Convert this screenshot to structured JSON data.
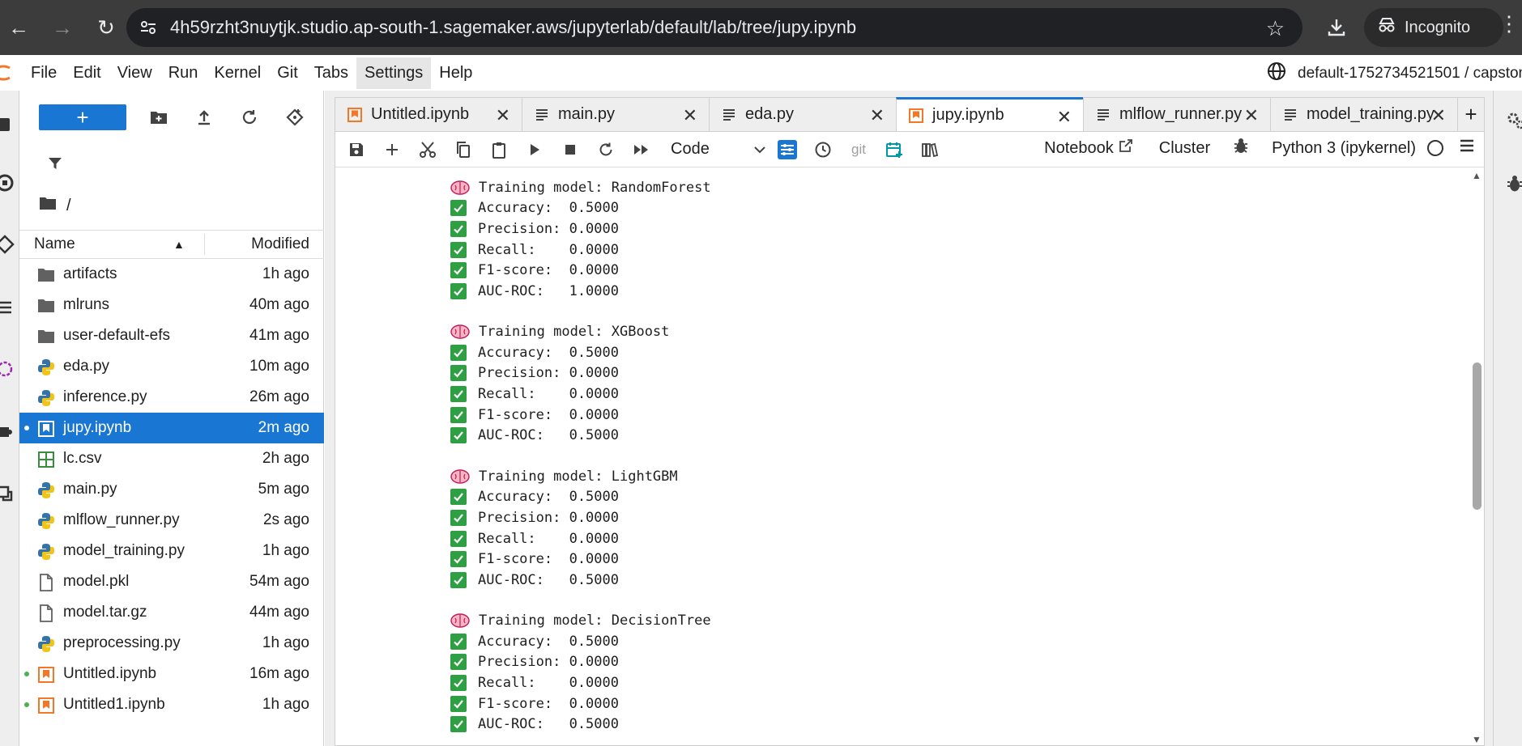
{
  "browser": {
    "url": "4h59rzht3nuytjk.studio.ap-south-1.sagemaker.aws/jupyterlab/default/lab/tree/jupy.ipynb",
    "incognito_label": "Incognito"
  },
  "menubar": {
    "items": [
      "File",
      "Edit",
      "View",
      "Run",
      "Kernel",
      "Git",
      "Tabs",
      "Settings",
      "Help"
    ],
    "active": "Settings",
    "workspace": "default-1752734521501 / capstone"
  },
  "filebrowser": {
    "path": "/",
    "columns": {
      "name": "Name",
      "modified": "Modified"
    },
    "files": [
      {
        "name": "artifacts",
        "modified": "1h ago",
        "type": "folder",
        "running": false,
        "selected": false
      },
      {
        "name": "mlruns",
        "modified": "40m ago",
        "type": "folder",
        "running": false,
        "selected": false
      },
      {
        "name": "user-default-efs",
        "modified": "41m ago",
        "type": "folder",
        "running": false,
        "selected": false
      },
      {
        "name": "eda.py",
        "modified": "10m ago",
        "type": "python",
        "running": false,
        "selected": false
      },
      {
        "name": "inference.py",
        "modified": "26m ago",
        "type": "python",
        "running": false,
        "selected": false
      },
      {
        "name": "jupy.ipynb",
        "modified": "2m ago",
        "type": "notebook",
        "running": true,
        "selected": true
      },
      {
        "name": "lc.csv",
        "modified": "2h ago",
        "type": "csv",
        "running": false,
        "selected": false
      },
      {
        "name": "main.py",
        "modified": "5m ago",
        "type": "python",
        "running": false,
        "selected": false
      },
      {
        "name": "mlflow_runner.py",
        "modified": "2s ago",
        "type": "python",
        "running": false,
        "selected": false
      },
      {
        "name": "model_training.py",
        "modified": "1h ago",
        "type": "python",
        "running": false,
        "selected": false
      },
      {
        "name": "model.pkl",
        "modified": "54m ago",
        "type": "file",
        "running": false,
        "selected": false
      },
      {
        "name": "model.tar.gz",
        "modified": "44m ago",
        "type": "file",
        "running": false,
        "selected": false
      },
      {
        "name": "preprocessing.py",
        "modified": "1h ago",
        "type": "python",
        "running": false,
        "selected": false
      },
      {
        "name": "Untitled.ipynb",
        "modified": "16m ago",
        "type": "notebook-orange",
        "running": true,
        "selected": false
      },
      {
        "name": "Untitled1.ipynb",
        "modified": "1h ago",
        "type": "notebook-orange",
        "running": true,
        "selected": false
      }
    ]
  },
  "tabs": [
    {
      "label": "Untitled.ipynb",
      "type": "notebook",
      "current": false
    },
    {
      "label": "main.py",
      "type": "text",
      "current": false
    },
    {
      "label": "eda.py",
      "type": "text",
      "current": false
    },
    {
      "label": "jupy.ipynb",
      "type": "notebook",
      "current": true
    },
    {
      "label": "mlflow_runner.py",
      "type": "text",
      "current": false
    },
    {
      "label": "model_training.py",
      "type": "text",
      "current": false
    }
  ],
  "notebook_toolbar": {
    "cell_type": "Code",
    "git_label": "git",
    "notebook_label": "Notebook",
    "cluster_label": "Cluster",
    "kernel_label": "Python 3 (ipykernel)"
  },
  "output": [
    {
      "header": "Training model: RandomForest",
      "metrics": [
        "Accuracy:  0.5000",
        "Precision: 0.0000",
        "Recall:    0.0000",
        "F1-score:  0.0000",
        "AUC-ROC:   1.0000"
      ]
    },
    {
      "header": "Training model: XGBoost",
      "metrics": [
        "Accuracy:  0.5000",
        "Precision: 0.0000",
        "Recall:    0.0000",
        "F1-score:  0.0000",
        "AUC-ROC:   0.5000"
      ]
    },
    {
      "header": "Training model: LightGBM",
      "metrics": [
        "Accuracy:  0.5000",
        "Precision: 0.0000",
        "Recall:    0.0000",
        "F1-score:  0.0000",
        "AUC-ROC:   0.5000"
      ]
    },
    {
      "header": "Training model: DecisionTree",
      "metrics": [
        "Accuracy:  0.5000",
        "Precision: 0.0000",
        "Recall:    0.0000",
        "F1-score:  0.0000",
        "AUC-ROC:   0.5000"
      ]
    }
  ],
  "colors": {
    "accent": "#1976d2",
    "check": "#2ea043",
    "notebook_icon": "#f37726"
  }
}
